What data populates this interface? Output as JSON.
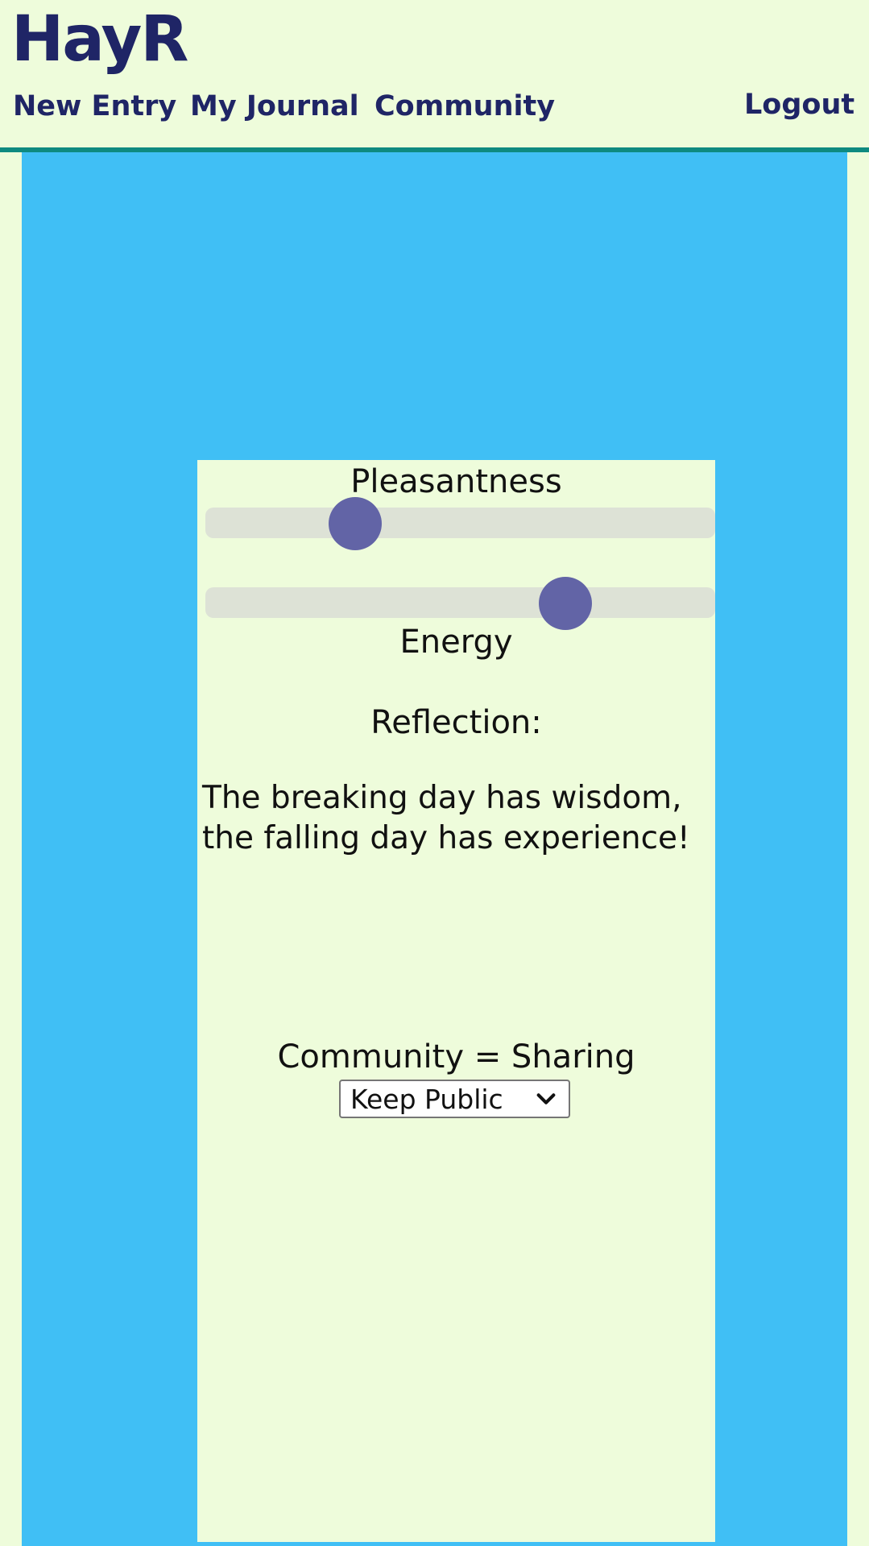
{
  "app": {
    "brand": "HayR"
  },
  "nav": {
    "new_entry": "New Entry",
    "my_journal": "My Journal",
    "community": "Community",
    "logout": "Logout"
  },
  "entry": {
    "pleasantness_label": "Pleasantness",
    "pleasantness_value": 0.27,
    "energy_label": "Energy",
    "energy_value": 0.73,
    "reflection_label": "Reflection:",
    "reflection_text": "The breaking day has wisdom, the falling day has experience!",
    "sharing_label": "Community = Sharing",
    "sharing_selected": "Keep Public"
  },
  "colors": {
    "background": "#eefcdb",
    "panel": "#40bff5",
    "brand": "#1f2566",
    "header_rule": "#0e8a80",
    "slider_thumb": "#6264a6",
    "slider_track": "#dde2d6"
  },
  "icons": {
    "select_arrow": "chevron-down-icon"
  }
}
